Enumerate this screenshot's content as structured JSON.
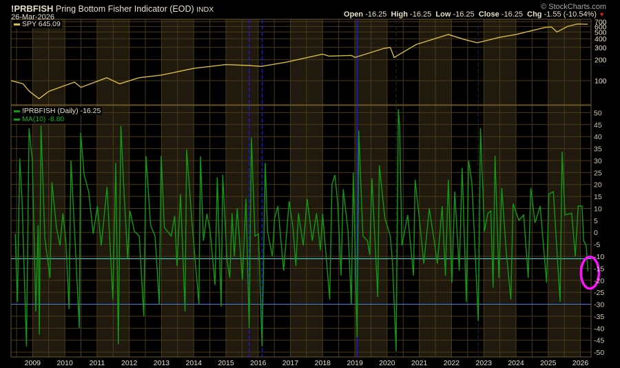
{
  "header": {
    "symbol": "!PRBFISH",
    "name": "Pring Bottom Fisher Indicator (EOD)",
    "exchange": "INDX",
    "date": "26-Mar-2026",
    "watermark": "© StockCharts.com",
    "open_label": "Open",
    "open": "-16.25",
    "high_label": "High",
    "high": "-16.25",
    "low_label": "Low",
    "low": "-16.25",
    "close_label": "Close",
    "close": "-16.25",
    "chg_label": "Chg",
    "chg": "-1.55 (-10.54%)",
    "chg_direction": "down"
  },
  "colors": {
    "background": "#000000",
    "grid": "#4a3a18",
    "band": "#201a0e",
    "spy": "#d8bc40",
    "indicator": "#129a12",
    "ma": "#129a12",
    "upper_threshold": "#40e0e0",
    "lower_threshold": "#4080e0",
    "marker": "#1818ff",
    "highlight": "#ff10ff"
  },
  "chart_data": [
    {
      "type": "line",
      "panel": "price",
      "scale": "log",
      "legend": "SPY 645.09",
      "ylim": [
        45,
        760
      ],
      "yticks": [
        100,
        200,
        300,
        400,
        500,
        600,
        700
      ],
      "xlim": [
        2008.33,
        2026.33
      ],
      "grid": true,
      "series": [
        {
          "name": "SPY",
          "x": [
            2008.33,
            2008.7,
            2008.9,
            2009.2,
            2009.5,
            2010.0,
            2010.3,
            2010.5,
            2011.3,
            2011.7,
            2012.3,
            2013.0,
            2014.0,
            2015.0,
            2015.7,
            2016.1,
            2016.9,
            2018.0,
            2018.2,
            2018.9,
            2019.0,
            2019.9,
            2020.1,
            2020.22,
            2020.9,
            2021.9,
            2022.4,
            2022.8,
            2023.5,
            2024.0,
            2024.9,
            2025.1,
            2025.27,
            2025.6,
            2025.9,
            2026.23
          ],
          "values": [
            100,
            90,
            70,
            55,
            70,
            85,
            95,
            80,
            110,
            90,
            110,
            120,
            150,
            170,
            165,
            160,
            185,
            240,
            225,
            230,
            215,
            290,
            300,
            215,
            330,
            460,
            390,
            350,
            420,
            460,
            580,
            590,
            500,
            600,
            650,
            645.09
          ]
        }
      ]
    },
    {
      "type": "line",
      "panel": "indicator",
      "legend": [
        "!PRBFISH (Daily) -16.25",
        "MA(10) -8.80"
      ],
      "ylim": [
        -52,
        53
      ],
      "yticks": [
        50,
        45,
        40,
        35,
        30,
        25,
        20,
        15,
        10,
        5,
        0,
        -5,
        -10,
        -15,
        -20,
        -25,
        -30,
        -35,
        -40,
        -45,
        -50
      ],
      "xlim": [
        2008.33,
        2026.33
      ],
      "xticks": [
        "2009",
        "2010",
        "2011",
        "2012",
        "2013",
        "2014",
        "2015",
        "2016",
        "2017",
        "2018",
        "2019",
        "2020",
        "2021",
        "2022",
        "2023",
        "2024",
        "2025",
        "2026"
      ],
      "grid": true,
      "shaded_years": [
        2009,
        2011,
        2013,
        2015,
        2017,
        2019,
        2021,
        2023,
        2025
      ],
      "horizontal_lines": [
        -11,
        -30
      ],
      "vertical_markers": [
        {
          "x": 2015.72,
          "style": "dashed",
          "color": "blue"
        },
        {
          "x": 2016.12,
          "style": "dashed",
          "color": "blue"
        },
        {
          "x": 2019.07,
          "style": "solid",
          "color": "blue"
        },
        {
          "x": 2020.28,
          "style": "dashed",
          "color": "dark"
        },
        {
          "x": 2022.83,
          "style": "dashed",
          "color": "dark"
        }
      ],
      "highlight": {
        "x": 2026.23,
        "y": -16.25,
        "shape": "ellipse"
      },
      "series": [
        {
          "name": "!PRBFISH",
          "x": [
            2008.46,
            2008.53,
            2008.6,
            2008.67,
            2008.81,
            2008.89,
            2008.99,
            2009.1,
            2009.17,
            2009.21,
            2009.26,
            2009.38,
            2009.54,
            2009.6,
            2009.74,
            2009.85,
            2009.94,
            2010.03,
            2010.13,
            2010.19,
            2010.31,
            2010.45,
            2010.49,
            2010.6,
            2010.74,
            2010.88,
            2011.01,
            2011.13,
            2011.31,
            2011.49,
            2011.58,
            2011.66,
            2011.74,
            2011.84,
            2011.95,
            2012.02,
            2012.16,
            2012.31,
            2012.45,
            2012.52,
            2012.66,
            2012.8,
            2012.93,
            2012.99,
            2013.09,
            2013.3,
            2013.41,
            2013.48,
            2013.59,
            2013.73,
            2013.78,
            2013.94,
            2014.16,
            2014.21,
            2014.3,
            2014.41,
            2014.51,
            2014.66,
            2014.73,
            2014.85,
            2014.9,
            2015.03,
            2015.12,
            2015.19,
            2015.26,
            2015.35,
            2015.51,
            2015.62,
            2015.72,
            2015.79,
            2015.9,
            2016.01,
            2016.12,
            2016.22,
            2016.29,
            2016.44,
            2016.51,
            2016.61,
            2016.79,
            2016.96,
            2017.08,
            2017.17,
            2017.25,
            2017.4,
            2017.52,
            2017.68,
            2017.81,
            2017.93,
            2018.0,
            2018.22,
            2018.29,
            2018.38,
            2018.47,
            2018.57,
            2018.64,
            2018.79,
            2018.89,
            2018.95,
            2019.07,
            2019.12,
            2019.25,
            2019.39,
            2019.46,
            2019.53,
            2019.71,
            2019.76,
            2019.93,
            2020.1,
            2020.17,
            2020.28,
            2020.35,
            2020.39,
            2020.46,
            2020.64,
            2020.82,
            2020.87,
            2020.96,
            2021.14,
            2021.31,
            2021.46,
            2021.56,
            2021.71,
            2021.81,
            2021.9,
            2022.01,
            2022.1,
            2022.24,
            2022.33,
            2022.46,
            2022.53,
            2022.63,
            2022.74,
            2022.83,
            2022.9,
            2023.02,
            2023.13,
            2023.22,
            2023.29,
            2023.35,
            2023.47,
            2023.56,
            2023.7,
            2023.84,
            2023.91,
            2024.09,
            2024.24,
            2024.38,
            2024.46,
            2024.59,
            2024.75,
            2024.95,
            2025.02,
            2025.16,
            2025.3,
            2025.37,
            2025.43,
            2025.52,
            2025.73,
            2025.84,
            2025.93,
            2026.05,
            2026.1,
            2026.18,
            2026.23
          ],
          "values": [
            -0.6,
            -29,
            30.8,
            14,
            -47.6,
            43.5,
            30,
            -33,
            3,
            -42.7,
            44.5,
            -2.5,
            -19,
            21,
            2,
            -5.5,
            8,
            -3.5,
            -32,
            30,
            -1.5,
            -40,
            41.6,
            24,
            17,
            -0.6,
            11,
            -5.5,
            19,
            -28,
            29,
            -46.7,
            44.5,
            16,
            -11,
            9,
            0.4,
            -1.5,
            -35,
            31.8,
            3,
            -1.5,
            -30,
            32,
            2,
            -1.5,
            7,
            -14,
            16,
            -33,
            34.7,
            5,
            -30,
            31.8,
            -3.5,
            7.8,
            0.4,
            -22,
            23,
            -31,
            24,
            -11,
            -19,
            8,
            -10,
            10,
            -20,
            14,
            -40,
            39.6,
            -1.5,
            -0.6,
            -47.6,
            29,
            0.4,
            -10,
            6,
            11,
            -16,
            13,
            2,
            -14,
            8,
            -5.5,
            14,
            -3.5,
            8,
            -7.5,
            7.8,
            -28,
            20,
            24,
            12,
            -18,
            18,
            0.4,
            -30,
            25,
            -43.7,
            42.5,
            -1.5,
            -3.5,
            -9.4,
            22.5,
            -27,
            28,
            6,
            -1.5,
            -13,
            -49.6,
            51.4,
            43.5,
            -5.5,
            7.3,
            -18,
            22,
            11,
            -13,
            10,
            -3.5,
            -13,
            11,
            -18,
            22,
            -21,
            17,
            -16,
            27,
            -29,
            30,
            21,
            -10,
            -37,
            43.5,
            0.4,
            8,
            9,
            -23,
            32,
            -19,
            18.5,
            -8.4,
            -28,
            12,
            5,
            7.3,
            -19,
            18.5,
            4,
            11,
            -21,
            16,
            17,
            -14,
            -29,
            33.7,
            7.3,
            8,
            -10,
            11,
            11,
            -3.5,
            -5.5,
            -16.25
          ]
        }
      ]
    }
  ]
}
